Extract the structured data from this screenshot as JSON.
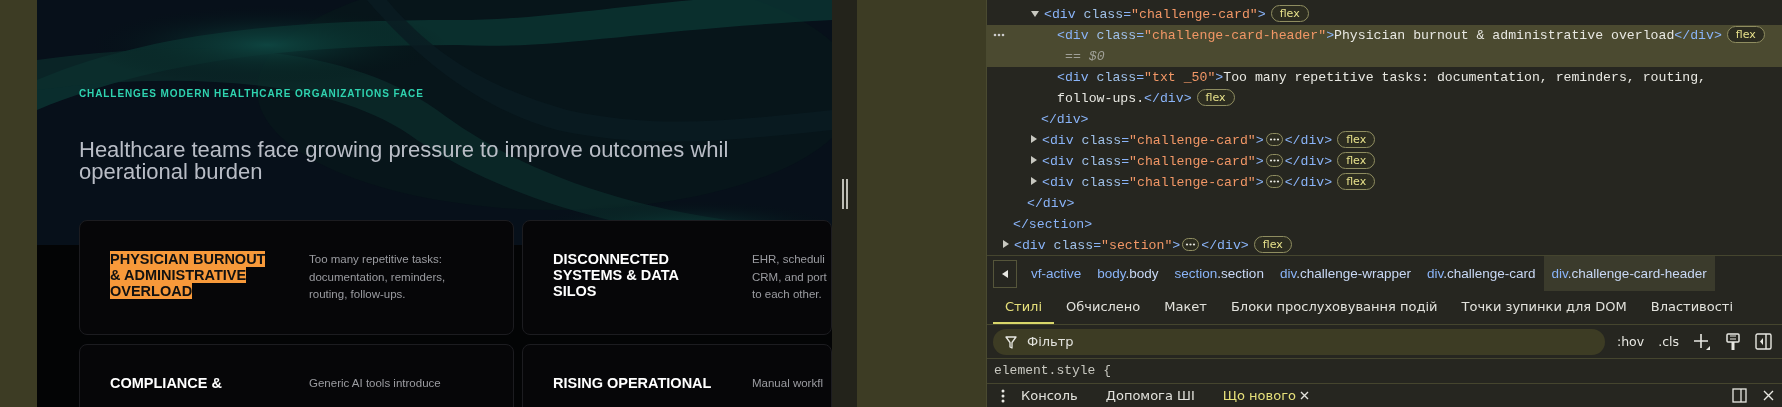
{
  "page": {
    "eyebrow": "CHALLENGES MODERN HEALTHCARE ORGANIZATIONS FACE",
    "heading_lines": [
      "Healthcare teams face growing pressure to improve outcomes whil",
      "operational burden"
    ],
    "cards": [
      {
        "header_lines": [
          "PHYSICIAN BURNOUT",
          "& ADMINISTRATIVE",
          "OVERLOAD"
        ],
        "highlighted": true,
        "description_lines": [
          "Too many repetitive tasks:",
          "documentation, reminders,",
          "routing, follow-ups."
        ]
      },
      {
        "header_lines": [
          "DISCONNECTED",
          "SYSTEMS & DATA",
          "SILOS"
        ],
        "highlighted": false,
        "description_lines": [
          "EHR, scheduli",
          "CRM, and port",
          "to each other."
        ]
      },
      {
        "header_lines": [
          "COMPLIANCE &"
        ],
        "highlighted": false,
        "description_lines": [
          "Generic AI tools introduce"
        ]
      },
      {
        "header_lines": [
          "RISING OPERATIONAL"
        ],
        "highlighted": false,
        "description_lines": [
          "Manual workfl"
        ]
      }
    ]
  },
  "devtools": {
    "dom_tree": [
      {
        "children": [
          {
            "children": [
              {
                "open": "<div class=\"challenge-card\">",
                "badge": "flex",
                "expanded": true,
                "selected": false,
                "close": "</div>",
                "children": [
                  {
                    "open": "<div class=\"challenge-card-header\">",
                    "text": "Physician burnout & administrative overload",
                    "close": "</div>",
                    "badge": "flex",
                    "marker": "== $0",
                    "selected": true
                  },
                  {
                    "open": "<div class=\"txt _50\">",
                    "text": "Too many repetitive tasks: documentation, reminders, routing, follow-ups.",
                    "close": "</div>",
                    "badge": "flex",
                    "selected": false
                  }
                ]
              },
              {
                "open": "<div class=\"challenge-card\">",
                "badge": "flex",
                "expanded": false,
                "selected": false,
                "close": "</div>"
              },
              {
                "open": "<div class=\"challenge-card\">",
                "badge": "flex",
                "expanded": false,
                "selected": false,
                "close": "</div>"
              },
              {
                "open": "<div class=\"challenge-card\">",
                "badge": "flex",
                "expanded": false,
                "selected": false,
                "close": "</div>"
              }
            ],
            "close": "</div>"
          }
        ],
        "close": "</section>"
      },
      {
        "open": "<div class=\"section\">",
        "badge": "flex",
        "expanded": false,
        "selected": false,
        "close": "</div>"
      }
    ],
    "breadcrumbs": [
      {
        "tag": "vf-active",
        "selected": false
      },
      {
        "tag": "body",
        "cls": ".body",
        "selected": false
      },
      {
        "tag": "section",
        "cls": ".section",
        "selected": false
      },
      {
        "tag": "div",
        "cls": ".challenge-wrapper",
        "selected": false
      },
      {
        "tag": "div",
        "cls": ".challenge-card",
        "selected": false
      },
      {
        "tag": "div",
        "cls": ".challenge-card-header",
        "selected": true
      }
    ],
    "tabs": [
      {
        "label": "Стилі",
        "selected": true
      },
      {
        "label": "Обчислено",
        "selected": false
      },
      {
        "label": "Макет",
        "selected": false
      },
      {
        "label": "Блоки прослуховування подій",
        "selected": false
      },
      {
        "label": "Точки зупинки для DOM",
        "selected": false
      },
      {
        "label": "Властивості",
        "selected": false
      }
    ],
    "filter": {
      "placeholder": "Фільтр"
    },
    "filter_tools": [
      ":hov",
      ".cls"
    ],
    "rule": "element.style {",
    "drawer_tabs": [
      {
        "label": "Консоль",
        "selected": false,
        "closable": false
      },
      {
        "label": "Допомога ШІ",
        "selected": false,
        "closable": false
      },
      {
        "label": "Що нового",
        "selected": true,
        "closable": true
      }
    ]
  }
}
